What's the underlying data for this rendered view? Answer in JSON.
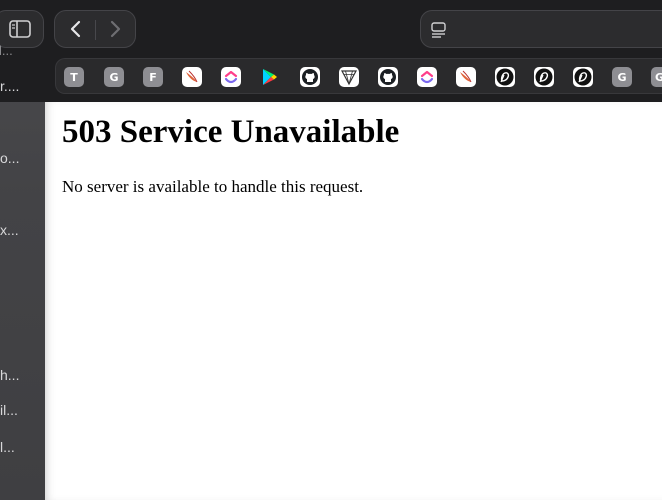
{
  "sidebar": {
    "items": [
      {
        "label": "l..."
      },
      {
        "label": "r...."
      },
      {
        "label": "o..."
      },
      {
        "label": "x..."
      },
      {
        "label": "h..."
      },
      {
        "label": "il..."
      },
      {
        "label": "l..."
      }
    ]
  },
  "favorites": [
    {
      "label": "T",
      "kind": "letter"
    },
    {
      "label": "G",
      "kind": "letter"
    },
    {
      "label": "F",
      "kind": "letter"
    },
    {
      "label": "",
      "kind": "bird-icon"
    },
    {
      "label": "",
      "kind": "clickup-icon"
    },
    {
      "label": "",
      "kind": "google-play-icon"
    },
    {
      "label": "",
      "kind": "github-icon"
    },
    {
      "label": "",
      "kind": "triangle-logo-icon"
    },
    {
      "label": "",
      "kind": "github-icon"
    },
    {
      "label": "",
      "kind": "clickup-icon"
    },
    {
      "label": "",
      "kind": "bird-icon"
    },
    {
      "label": "",
      "kind": "d-logo-icon"
    },
    {
      "label": "",
      "kind": "d-logo-icon"
    },
    {
      "label": "",
      "kind": "d-logo-icon"
    },
    {
      "label": "G",
      "kind": "letter"
    },
    {
      "label": "G",
      "kind": "letter"
    }
  ],
  "page": {
    "heading": "503 Service Unavailable",
    "message": "No server is available to handle this request."
  }
}
